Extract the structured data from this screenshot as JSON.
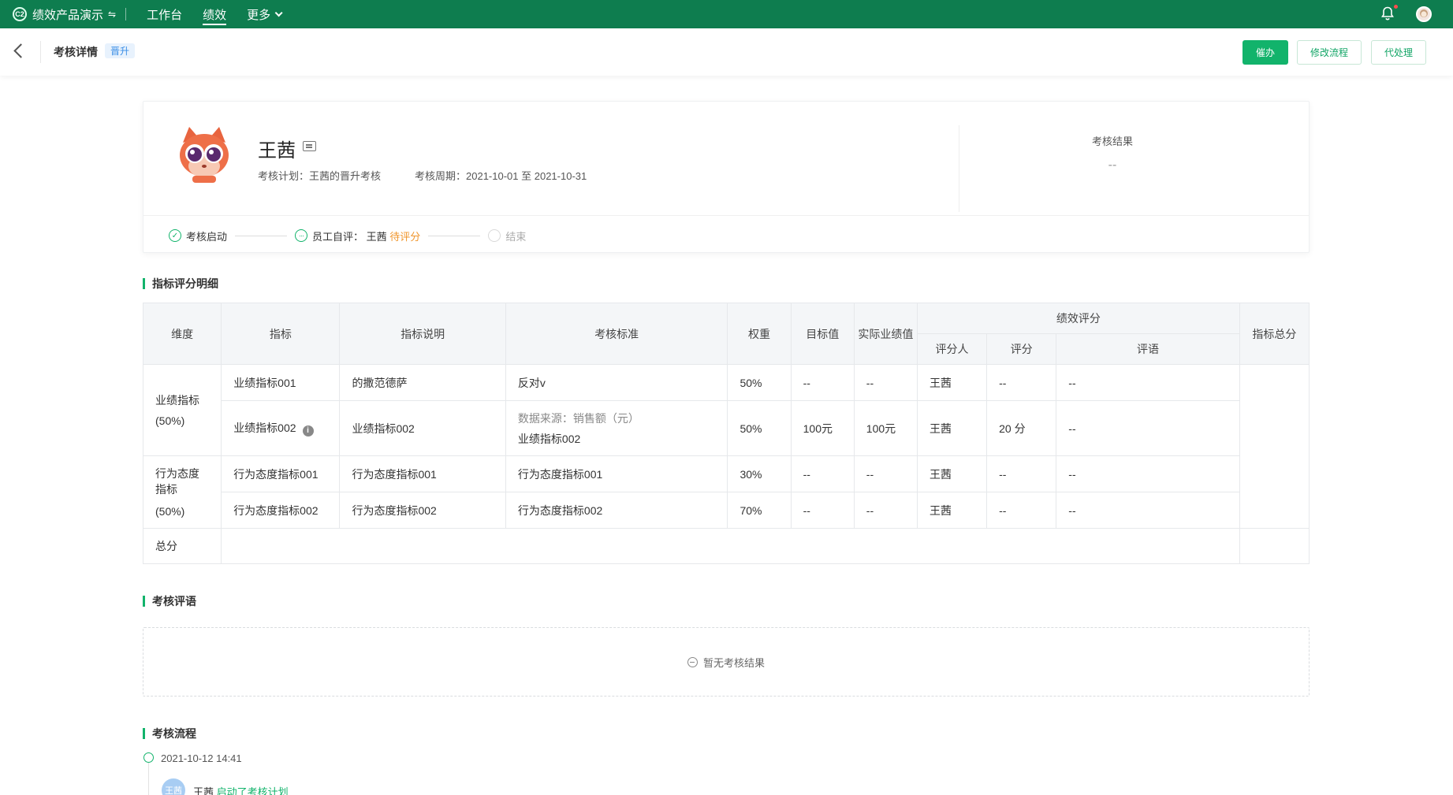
{
  "topbar": {
    "logo_text": "C2",
    "app_name": "绩效产品演示",
    "switch_icon": "⇋",
    "nav": [
      "工作台",
      "绩效",
      "更多"
    ],
    "active_nav": "绩效"
  },
  "subheader": {
    "title": "考核详情",
    "tag": "晋升",
    "buttons": {
      "urge": "催办",
      "modify": "修改流程",
      "proxy": "代处理"
    }
  },
  "profile": {
    "name": "王茜",
    "plan_label": "考核计划：",
    "plan_value": "王茜的晋升考核",
    "period_label": "考核周期：",
    "period_value": "2021-10-01 至 2021-10-31",
    "result_label": "考核结果",
    "result_value": "--"
  },
  "steps": {
    "s1": "考核启动",
    "s2_prefix": "员工自评：",
    "s2_name": "王茜",
    "s2_status": "待评分",
    "s3": "结束"
  },
  "sections": {
    "detail": "指标评分明细",
    "comment": "考核评语",
    "process": "考核流程"
  },
  "table": {
    "headers": {
      "dimension": "维度",
      "indicator": "指标",
      "desc": "指标说明",
      "standard": "考核标准",
      "weight": "权重",
      "target": "目标值",
      "actual": "实际业绩值",
      "perf": "绩效评分",
      "rater": "评分人",
      "score": "评分",
      "remark": "评语",
      "total": "指标总分"
    },
    "groups": [
      {
        "dimension": "业绩指标",
        "dimension_pct": "(50%)",
        "rows": [
          {
            "indicator": "业绩指标001",
            "desc": "的撒范德萨",
            "standard": "反对v",
            "standard_line2": "",
            "weight": "50%",
            "target": "--",
            "actual": "--",
            "rater": "王茜",
            "score": "--",
            "remark": "--"
          },
          {
            "indicator": "业绩指标002",
            "desc": "业绩指标002",
            "standard": "数据来源：销售额（元）",
            "standard_line2": "业绩指标002",
            "weight": "50%",
            "target": "100元",
            "actual": "100元",
            "rater": "王茜",
            "score": "20 分",
            "remark": "--"
          }
        ]
      },
      {
        "dimension": "行为态度指标",
        "dimension_pct": "(50%)",
        "rows": [
          {
            "indicator": "行为态度指标001",
            "desc": "行为态度指标001",
            "standard": "行为态度指标001",
            "weight": "30%",
            "target": "--",
            "actual": "--",
            "rater": "王茜",
            "score": "--",
            "remark": "--"
          },
          {
            "indicator": "行为态度指标002",
            "desc": "行为态度指标002",
            "standard": "行为态度指标002",
            "weight": "70%",
            "target": "--",
            "actual": "--",
            "rater": "王茜",
            "score": "--",
            "remark": "--"
          }
        ]
      }
    ],
    "total_label": "总分",
    "info_icon": "i"
  },
  "comment": {
    "empty": "暂无考核结果"
  },
  "timeline": [
    {
      "time": "2021-10-12 14:41",
      "avatar": "王茜",
      "user": "王茜",
      "action": "启动了考核计划"
    }
  ],
  "colors": {
    "brand": "#0e7d4f",
    "accent": "#12b36b",
    "pending": "#f0962d"
  }
}
